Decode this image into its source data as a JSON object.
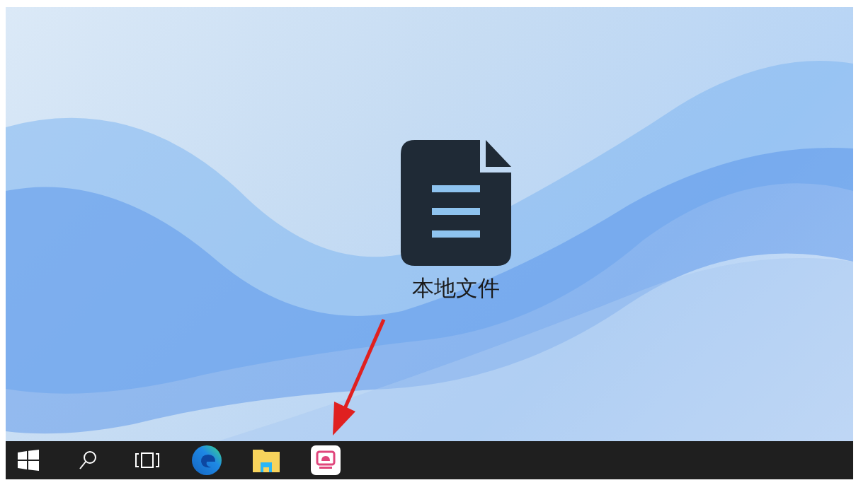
{
  "desktop_icons": [
    {
      "label": "本地文件",
      "kind": "document"
    }
  ],
  "taskbar": {
    "items": [
      {
        "kind": "start"
      },
      {
        "kind": "search"
      },
      {
        "kind": "task_view"
      },
      {
        "kind": "browser"
      },
      {
        "kind": "folder"
      },
      {
        "kind": "app"
      }
    ]
  }
}
